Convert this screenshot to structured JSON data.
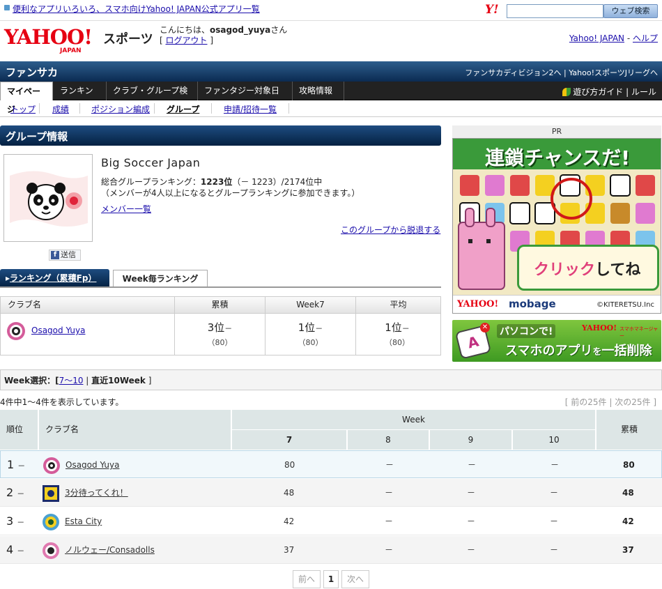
{
  "topbar": {
    "app_link": "便利なアプリいろいろ、スマホ向けYahoo! JAPAN公式アプリ一覧",
    "yahoo_mark": "Y!",
    "search_placeholder": "",
    "search_button": "ウェブ検索"
  },
  "header": {
    "logo_main": "YAHOO!",
    "logo_sub": "JAPAN",
    "sports": "スポーツ",
    "greeting_prefix": "こんにちは、",
    "username": "osagod_yuya",
    "greeting_suffix": "さん",
    "logout": "ログアウト",
    "yahoo_japan_link": "Yahoo! JAPAN",
    "help_link": "ヘルプ"
  },
  "nav": {
    "title": "ファンサカ",
    "right_link1": "ファンサカディビジョン2へ",
    "right_link2": "Yahoo!スポーツJリーグへ",
    "tabs": [
      "マイページ",
      "ランキング",
      "クラブ・グループ検索",
      "ファンタジー対象日程",
      "攻略情報"
    ],
    "guide": "遊び方ガイド",
    "rules": "ルール",
    "subtabs": [
      "トップ",
      "成績",
      "ポジション編成",
      "グループ",
      "申請/招待一覧"
    ]
  },
  "group": {
    "header": "グループ情報",
    "name": "Big Soccer Japan",
    "rank_label": "総合グループランキング：",
    "rank_value": "1223位",
    "rank_detail": "（－ 1223）/2174位中",
    "note": "（メンバーが4人以上になるとグループランキングに参加できます。）",
    "members_link": "メンバー一覧",
    "leave_link": "このグループから脱退する",
    "fb_label": "送信"
  },
  "ranking_tabs": {
    "tab1": "ランキング（累積Fp）",
    "tab2": "Week毎ランキング"
  },
  "summary_table": {
    "headers": [
      "クラブ名",
      "累積",
      "Week7",
      "平均"
    ],
    "club": "Osagod Yuya",
    "cells": [
      {
        "pos": "3位",
        "change": "－",
        "sub": "（80）"
      },
      {
        "pos": "1位",
        "change": "－",
        "sub": "（80）"
      },
      {
        "pos": "1位",
        "change": "－",
        "sub": "（80）"
      }
    ]
  },
  "ads": {
    "pr_label": "PR",
    "ad1_title": "連鎖チャンスだ!",
    "ad1_bubble_pink": "クリック",
    "ad1_bubble_black": "してね",
    "ad1_footer_yahoo": "YAHOO!",
    "ad1_footer_mobage": "mobage",
    "ad1_footer_copy": "©KITERETSU.Inc",
    "ad2_line1": "パソコンで!",
    "ad2_brand": "YAHOO!",
    "ad2_brand_sub": "スマホマネージャー",
    "ad2_line2_a": "スマホのアプリ",
    "ad2_line2_b": "を",
    "ad2_line2_c": "一括削除"
  },
  "week_select": {
    "label": "Week選択：[",
    "link": "7〜10",
    "sep": " | ",
    "current": "直近10Week",
    "close": " ]"
  },
  "listing": {
    "count_text": "4件中1〜4件を表示しています。",
    "prev25": "前の25件",
    "next25": "次の25件"
  },
  "main_table": {
    "h_rank": "順位",
    "h_club": "クラブ名",
    "h_week": "Week",
    "h_total": "累積",
    "weeks": [
      "7",
      "8",
      "9",
      "10"
    ],
    "rows": [
      {
        "rank": "1",
        "change": "－",
        "club": "Osagod Yuya",
        "w": [
          "80",
          "－",
          "－",
          "－"
        ],
        "total": "80"
      },
      {
        "rank": "2",
        "change": "－",
        "club": "3分待ってくれ！",
        "w": [
          "48",
          "－",
          "－",
          "－"
        ],
        "total": "48"
      },
      {
        "rank": "3",
        "change": "－",
        "club": "Esta City",
        "w": [
          "42",
          "－",
          "－",
          "－"
        ],
        "total": "42"
      },
      {
        "rank": "4",
        "change": "－",
        "club": "ノルウェー/Consadolls",
        "w": [
          "37",
          "－",
          "－",
          "－"
        ],
        "total": "37"
      }
    ]
  },
  "pager": {
    "prev": "前へ",
    "page": "1",
    "next": "次へ"
  }
}
